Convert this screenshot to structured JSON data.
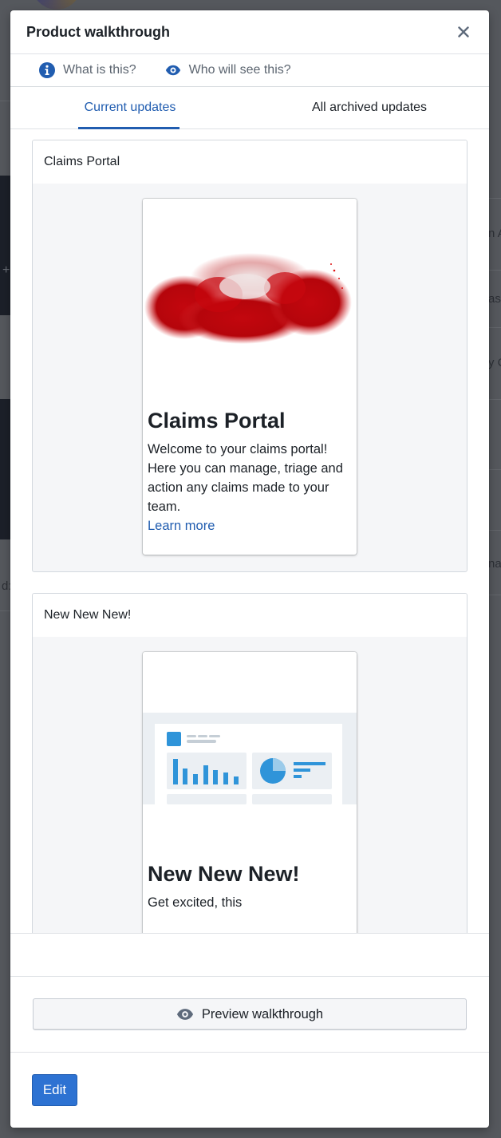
{
  "modal": {
    "title": "Product walkthrough",
    "close_icon": "close-icon",
    "info_links": [
      {
        "icon": "info-icon",
        "label": "What is this?"
      },
      {
        "icon": "eye-icon",
        "label": "Who will see this?"
      }
    ],
    "tabs": [
      {
        "label": "Current updates",
        "active": true
      },
      {
        "label": "All archived updates",
        "active": false
      }
    ],
    "updates": [
      {
        "header": "Claims Portal",
        "image": "red-smoke-image",
        "title": "Claims Portal",
        "description": "Welcome to your claims portal! Here you can manage, triage and action any claims made to your team.",
        "link": "Learn more"
      },
      {
        "header": "New New New!",
        "image": "dashboard-illustration",
        "title": "New New New!",
        "description": "Get excited, this update will thrill you...",
        "description_visible": "Get excited, this"
      }
    ],
    "preview_button": {
      "icon": "eye-icon",
      "label": "Preview walkthrough"
    },
    "edit_button": "Edit"
  },
  "colors": {
    "accent": "#215db0",
    "primary_button": "#2d72d2",
    "illustration_blue": "#2f94d9"
  },
  "background": {
    "right_edge_texts": [
      "n A",
      "ass",
      "y C",
      "na"
    ],
    "left_edge_texts": [
      "d:"
    ]
  }
}
